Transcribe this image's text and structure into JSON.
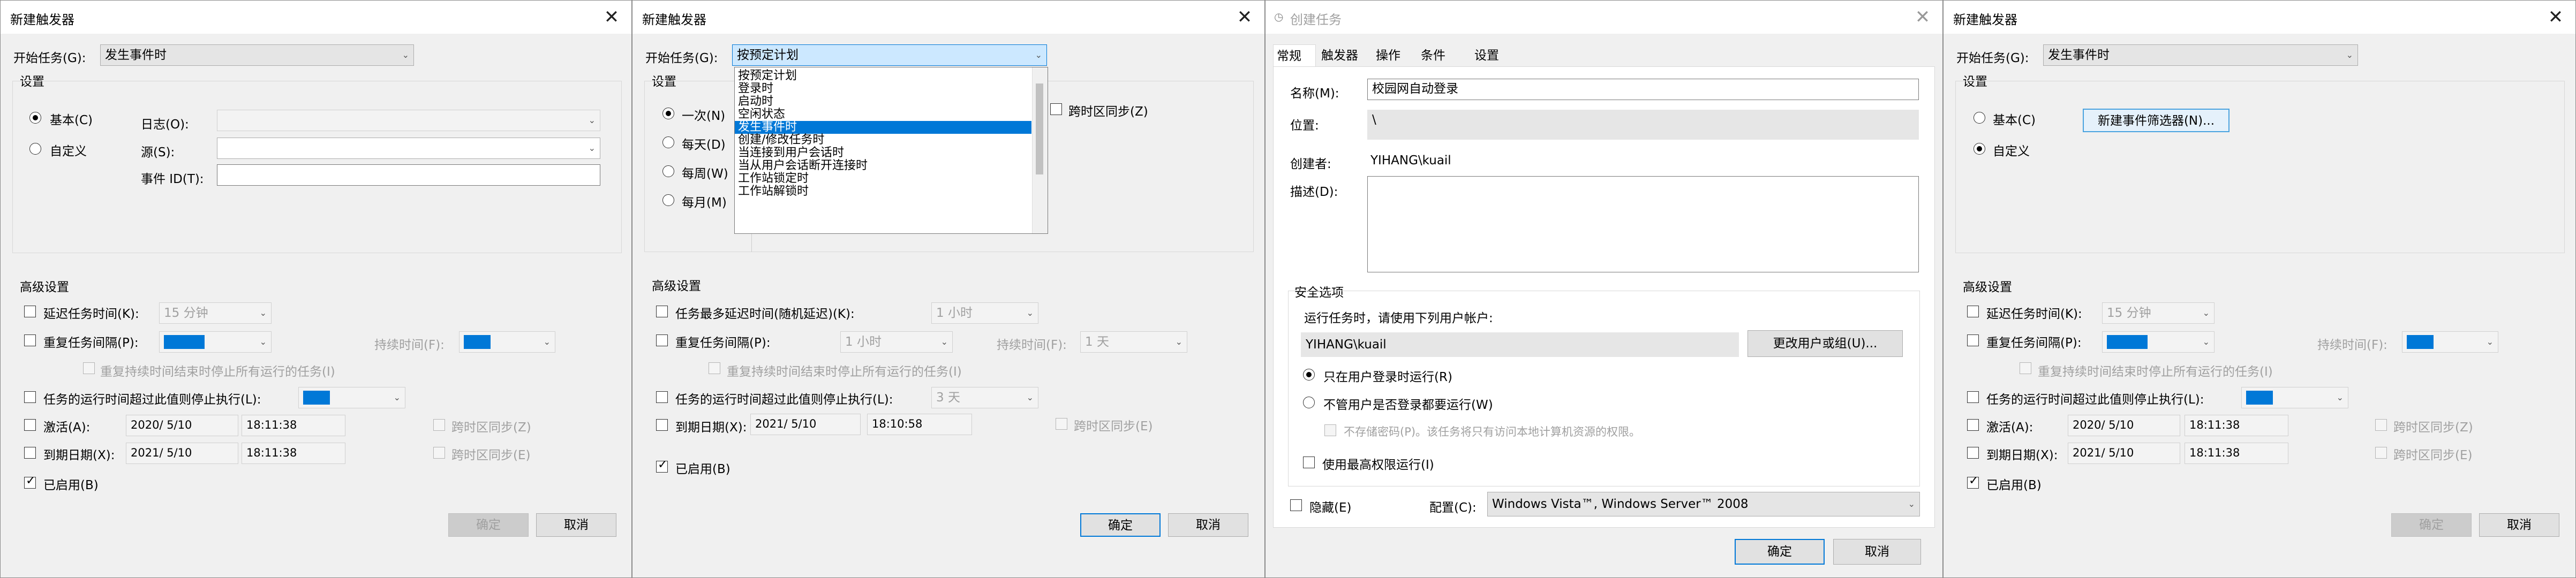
{
  "common": {
    "close_glyph": "✕",
    "dropdown_glyph": "⌄",
    "checkmark": "✓",
    "accent_color": "#0078d7"
  },
  "win1": {
    "title": "新建触发器",
    "start_task_label": "开始任务(G):",
    "start_task_value": "发生事件时",
    "settings_label": "设置",
    "basic_label": "基本(C)",
    "custom_label": "自定义",
    "log_label": "日志(O):",
    "source_label": "源(S):",
    "event_id_label": "事件 ID(T):",
    "advanced_label": "高级设置",
    "delay_label": "延迟任务时间(K):",
    "delay_value": "15 分钟",
    "repeat_label": "重复任务间隔(P):",
    "duration_label": "持续时间(F):",
    "stop_repeat_label": "重复持续时间结束时停止所有运行的任务(I)",
    "stop_if_longer_label": "任务的运行时间超过此值则停止执行(L):",
    "activate_label": "激活(A):",
    "activate_date": "2020/ 5/10",
    "activate_time": "18:11:38",
    "expire_label": "到期日期(X):",
    "expire_date": "2021/ 5/10",
    "expire_time": "18:11:38",
    "sync_tz_1": "跨时区同步(Z)",
    "sync_tz_2": "跨时区同步(E)",
    "enabled_label": "已启用(B)",
    "ok": "确定",
    "cancel": "取消"
  },
  "win2": {
    "title": "新建触发器",
    "start_task_label": "开始任务(G):",
    "start_task_value": "按预定计划",
    "settings_label": "设置",
    "once_label": "一次(N)",
    "daily_label": "每天(D)",
    "weekly_label": "每周(W)",
    "monthly_label": "每月(M)",
    "sync_tz_label": "跨时区同步(Z)",
    "dropdown_options": [
      "按预定计划",
      "登录时",
      "启动时",
      "空闲状态",
      "发生事件时",
      "创建/修改任务时",
      "当连接到用户会话时",
      "当从用户会话断开连接时",
      "工作站锁定时",
      "工作站解锁时"
    ],
    "advanced_label": "高级设置",
    "delay_label": "任务最多延迟时间(随机延迟)(K):",
    "delay_value": "1 小时",
    "repeat_label": "重复任务间隔(P):",
    "repeat_value": "1 小时",
    "duration_label": "持续时间(F):",
    "duration_value": "1 天",
    "stop_repeat_label": "重复持续时间结束时停止所有运行的任务(I)",
    "stop_if_longer_label": "任务的运行时间超过此值则停止执行(L):",
    "stop_if_longer_value": "3 天",
    "expire_label": "到期日期(X):",
    "expire_date": "2021/ 5/10",
    "expire_time": "18:10:58",
    "sync_tz_2": "跨时区同步(E)",
    "enabled_label": "已启用(B)",
    "ok": "确定",
    "cancel": "取消"
  },
  "win3": {
    "title": "创建任务",
    "tabs": [
      "常规",
      "触发器",
      "操作",
      "条件",
      "设置"
    ],
    "name_label": "名称(M):",
    "name_value": "校园网自动登录",
    "location_label": "位置:",
    "location_value": "\\",
    "author_label": "创建者:",
    "author_value": "YIHANG\\kuail",
    "desc_label": "描述(D):",
    "security_label": "安全选项",
    "run_as_label": "运行任务时，请使用下列用户帐户:",
    "run_as_value": "YIHANG\\kuail",
    "change_user_button": "更改用户或组(U)...",
    "only_logged_on": "只在用户登录时运行(R)",
    "whether_logged_on": "不管用户是否登录都要运行(W)",
    "no_store_password": "不存储密码(P)。该任务将只有访问本地计算机资源的权限。",
    "highest_priv": "使用最高权限运行(I)",
    "hidden_label": "隐藏(E)",
    "config_label": "配置(C):",
    "config_value": "Windows Vista™, Windows Server™ 2008",
    "ok": "确定",
    "cancel": "取消"
  },
  "win4": {
    "title": "新建触发器",
    "start_task_label": "开始任务(G):",
    "start_task_value": "发生事件时",
    "settings_label": "设置",
    "basic_label": "基本(C)",
    "custom_label": "自定义",
    "new_filter_button": "新建事件筛选器(N)...",
    "advanced_label": "高级设置",
    "delay_label": "延迟任务时间(K):",
    "delay_value": "15 分钟",
    "repeat_label": "重复任务间隔(P):",
    "duration_label": "持续时间(F):",
    "stop_repeat_label": "重复持续时间结束时停止所有运行的任务(I)",
    "stop_if_longer_label": "任务的运行时间超过此值则停止执行(L):",
    "activate_label": "激活(A):",
    "activate_date": "2020/ 5/10",
    "activate_time": "18:11:38",
    "expire_label": "到期日期(X):",
    "expire_date": "2021/ 5/10",
    "expire_time": "18:11:38",
    "sync_tz_1": "跨时区同步(Z)",
    "sync_tz_2": "跨时区同步(E)",
    "enabled_label": "已启用(B)",
    "ok": "确定",
    "cancel": "取消"
  }
}
